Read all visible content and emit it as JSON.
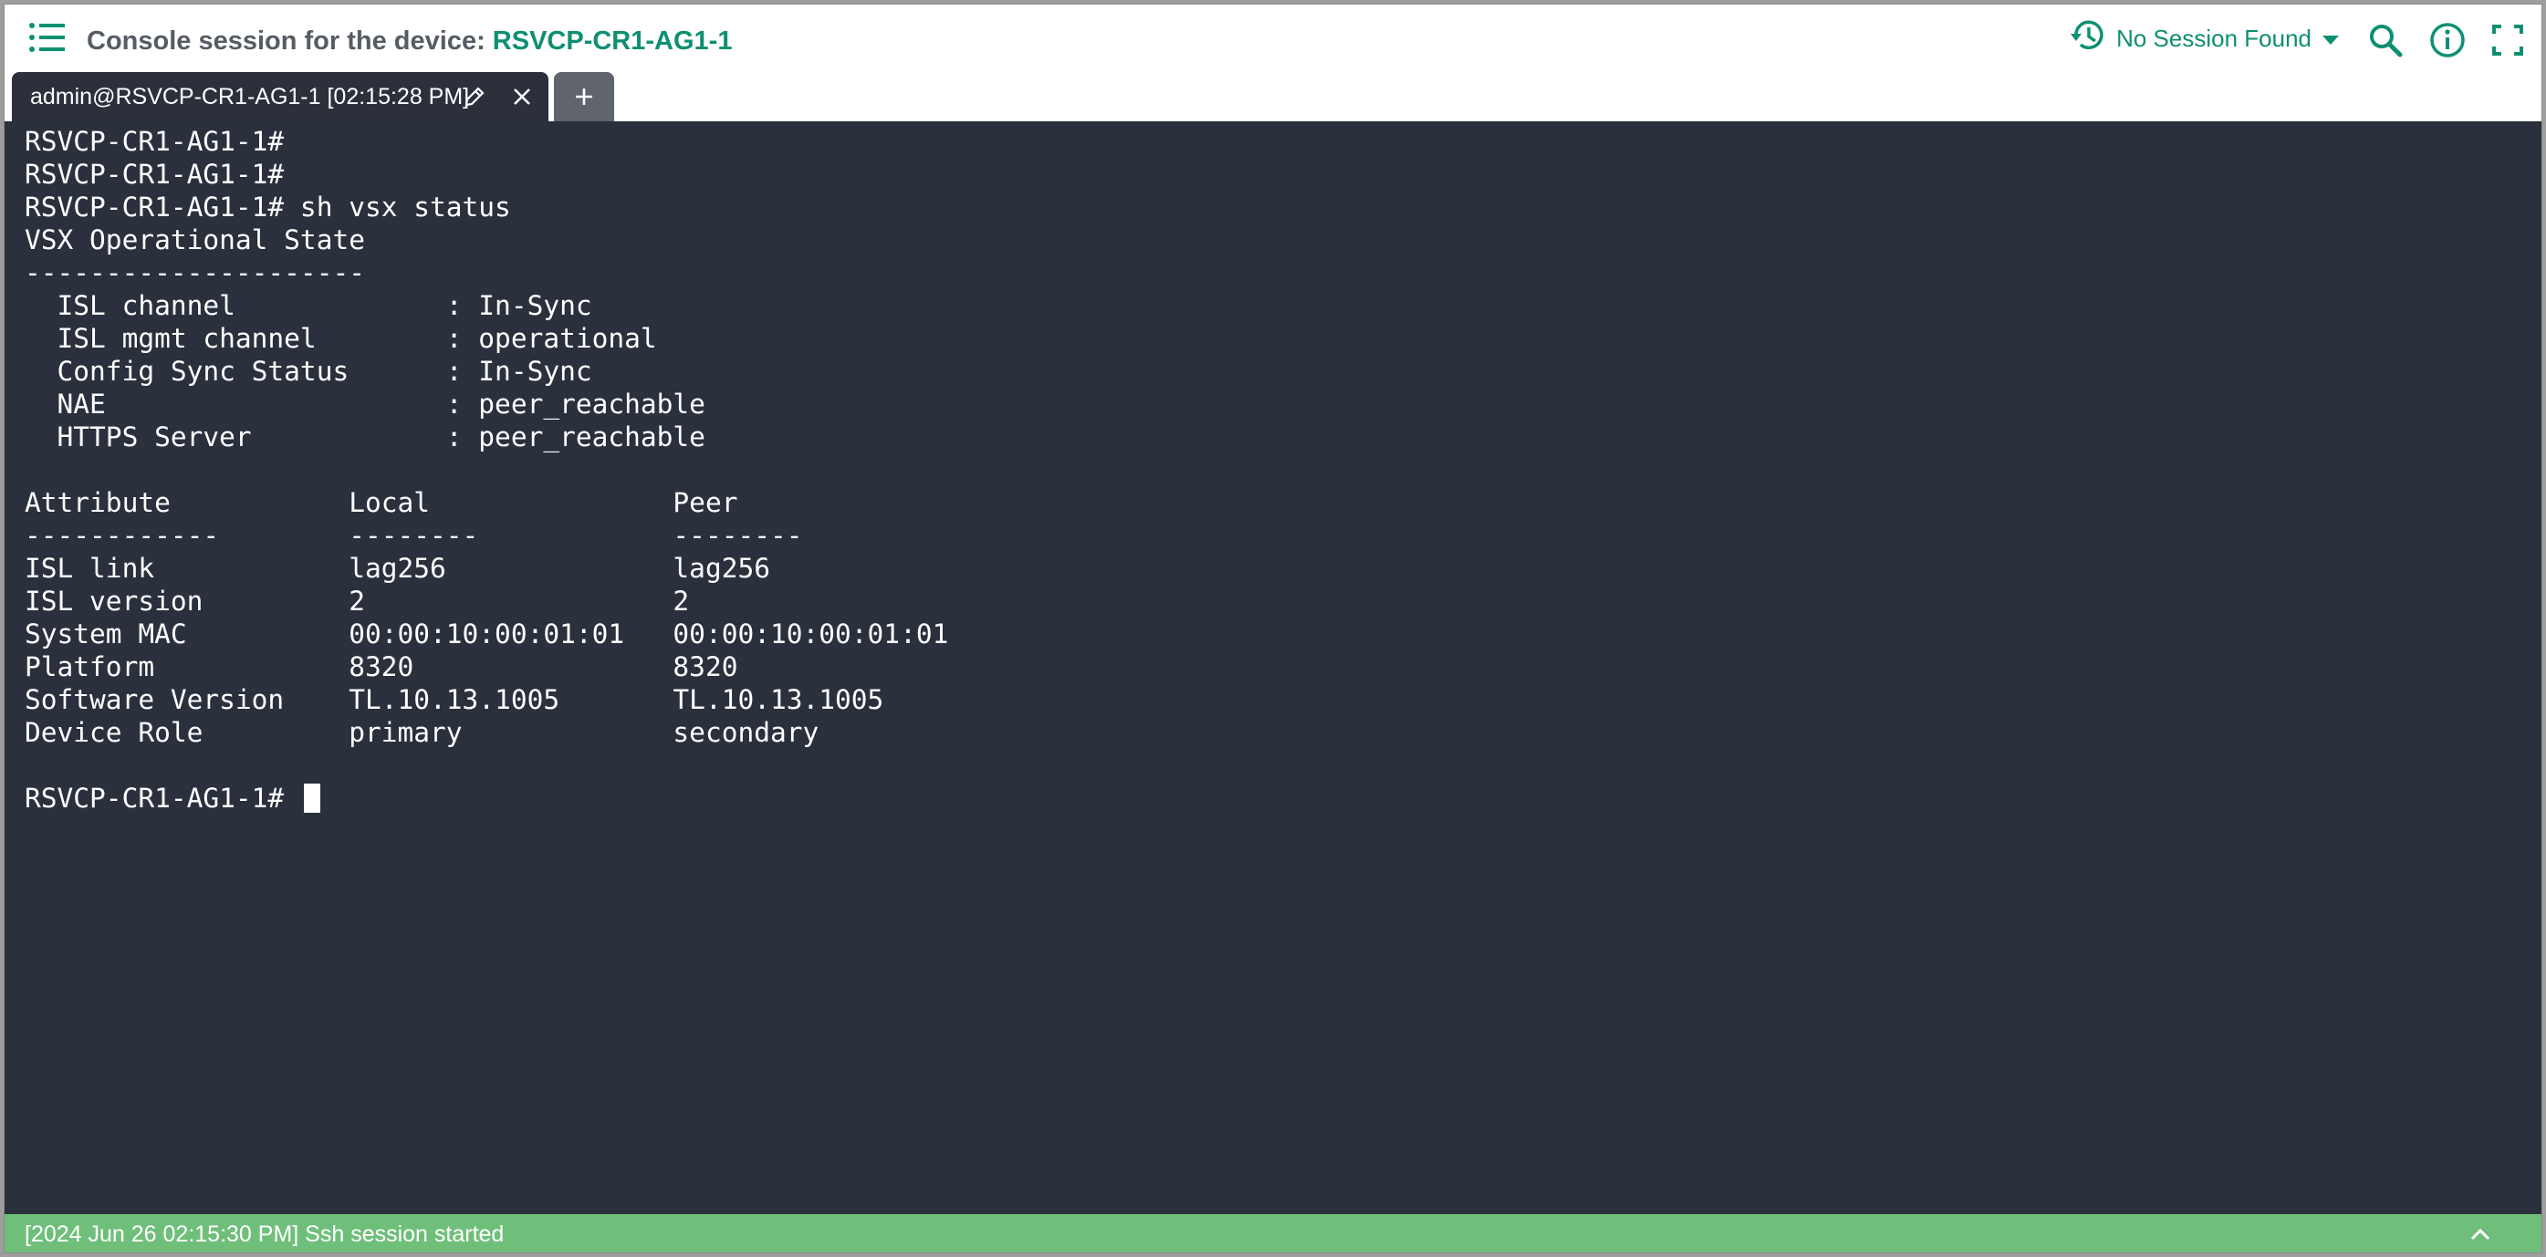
{
  "header": {
    "title_prefix": "Console session for the device:",
    "device_name": "RSVCP-CR1-AG1-1",
    "session_picker_label": "No Session Found",
    "icons": [
      "list-menu-icon",
      "history-icon",
      "caret-down-icon",
      "search-icon",
      "info-icon",
      "fullscreen-icon"
    ]
  },
  "tabs": [
    {
      "label": "admin@RSVCP-CR1-AG1-1 [02:15:28 PM]",
      "active": true
    }
  ],
  "add_tab_icon": "plus-icon",
  "terminal": {
    "lines": [
      "RSVCP-CR1-AG1-1#",
      "RSVCP-CR1-AG1-1#",
      "RSVCP-CR1-AG1-1# sh vsx status",
      "VSX Operational State",
      "---------------------",
      "  ISL channel             : In-Sync",
      "  ISL mgmt channel        : operational",
      "  Config Sync Status      : In-Sync",
      "  NAE                     : peer_reachable",
      "  HTTPS Server            : peer_reachable",
      "",
      "Attribute           Local               Peer",
      "------------        --------            --------",
      "ISL link            lag256              lag256",
      "ISL version         2                   2",
      "System MAC          00:00:10:00:01:01   00:00:10:00:01:01",
      "Platform            8320                8320",
      "Software Version    TL.10.13.1005       TL.10.13.1005",
      "Device Role         primary             secondary",
      ""
    ],
    "prompt": "RSVCP-CR1-AG1-1# "
  },
  "status_bar": {
    "message": "[2024 Jun 26 02:15:30 PM] Ssh session started"
  },
  "colors": {
    "accent": "#0e8f72",
    "terminal_bg": "#2a303c",
    "tab_bg": "#2b303a",
    "status_bg": "#6fbf7b"
  }
}
